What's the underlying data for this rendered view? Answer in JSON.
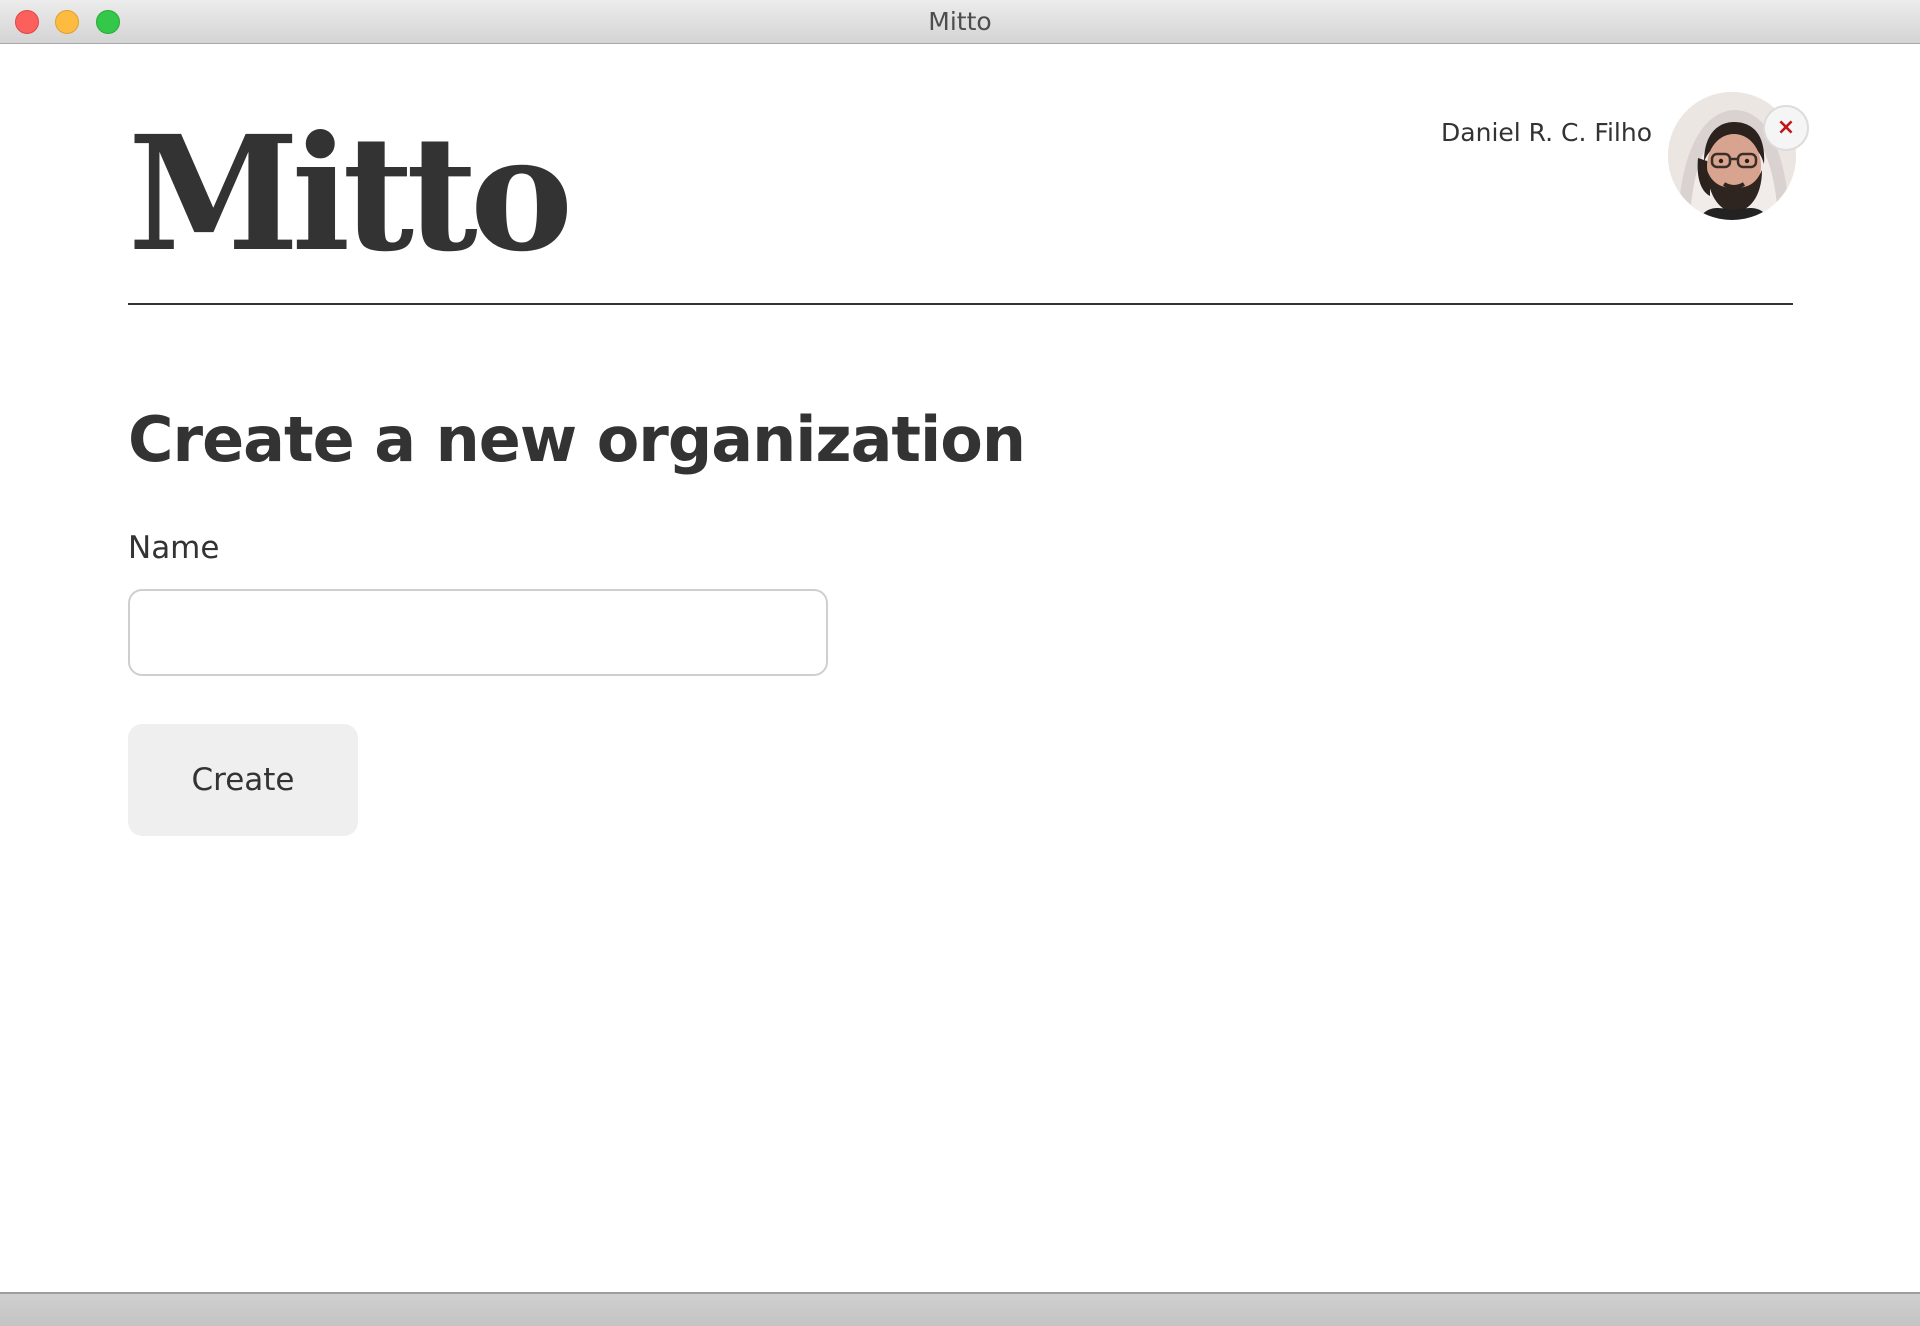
{
  "window": {
    "title": "Mitto"
  },
  "header": {
    "logo_text": "Mitto",
    "user_name": "Daniel R. C. Filho",
    "logout_symbol": "×"
  },
  "main": {
    "heading": "Create a new organization",
    "name_label": "Name",
    "name_value": "",
    "create_label": "Create"
  },
  "colors": {
    "text": "#333333",
    "logout_x": "#c0161b",
    "button_bg": "#efefef",
    "input_border": "#cfcfcf"
  }
}
